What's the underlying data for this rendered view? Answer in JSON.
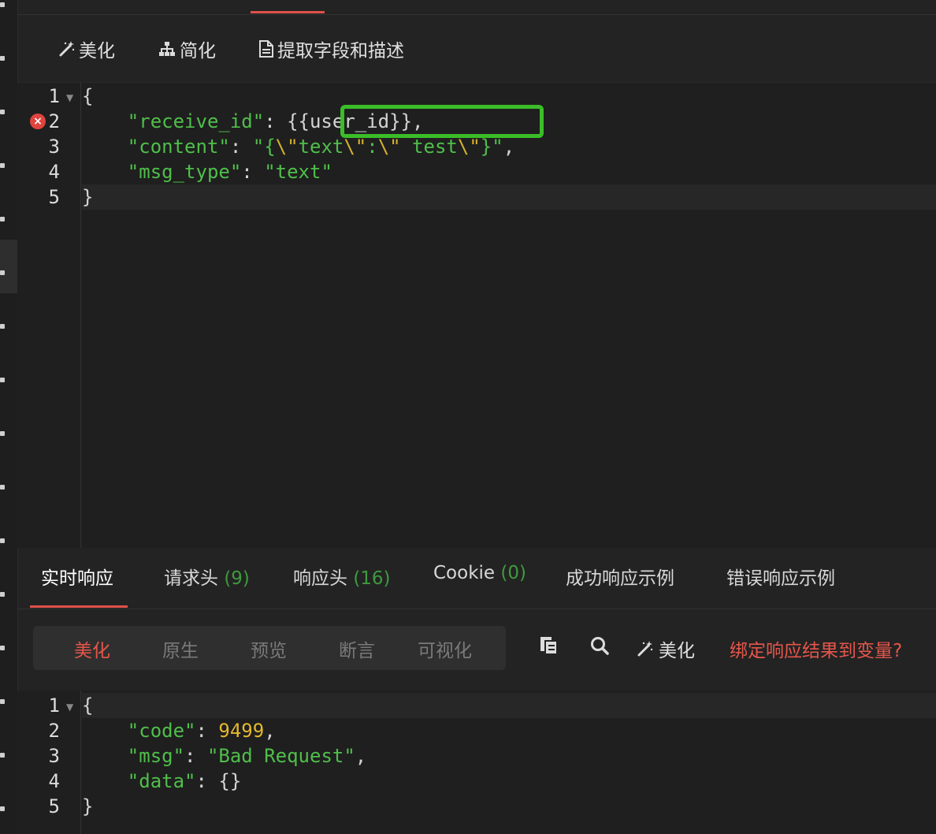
{
  "request_toolbar": {
    "beautify": "美化",
    "simplify": "简化",
    "extract": "提取字段和描述"
  },
  "request_body": {
    "line_numbers": [
      "1",
      "2",
      "3",
      "4",
      "5"
    ],
    "error_line": "2",
    "lines": [
      "{",
      "    \"receive_id\": {{user_id}},",
      "    \"content\": \"{\\\"text\\\":\\\" test\\\"}\",",
      "    \"msg_type\": \"text\"",
      "}"
    ]
  },
  "response_tabs": [
    {
      "label": "实时响应",
      "count": ""
    },
    {
      "label": "请求头",
      "count": "(9)"
    },
    {
      "label": "响应头",
      "count": "(16)"
    },
    {
      "label": "Cookie",
      "count": "(0)"
    },
    {
      "label": "成功响应示例",
      "count": ""
    },
    {
      "label": "错误响应示例",
      "count": ""
    }
  ],
  "view_modes": [
    "美化",
    "原生",
    "预览",
    "断言",
    "可视化"
  ],
  "response_tools": {
    "beautify": "美化",
    "bind_link": "绑定响应结果到变量?"
  },
  "response_body": {
    "line_numbers": [
      "1",
      "2",
      "3",
      "4",
      "5"
    ],
    "lines": [
      "{",
      "    \"code\": 9499,",
      "    \"msg\": \"Bad Request\",",
      "    \"data\": {}",
      "}"
    ]
  },
  "colors": {
    "accent_red": "#e0504a",
    "json_key_green": "#4fbf4a",
    "number_yellow": "#e5b82e",
    "highlight_box_green": "#3bbd29"
  }
}
